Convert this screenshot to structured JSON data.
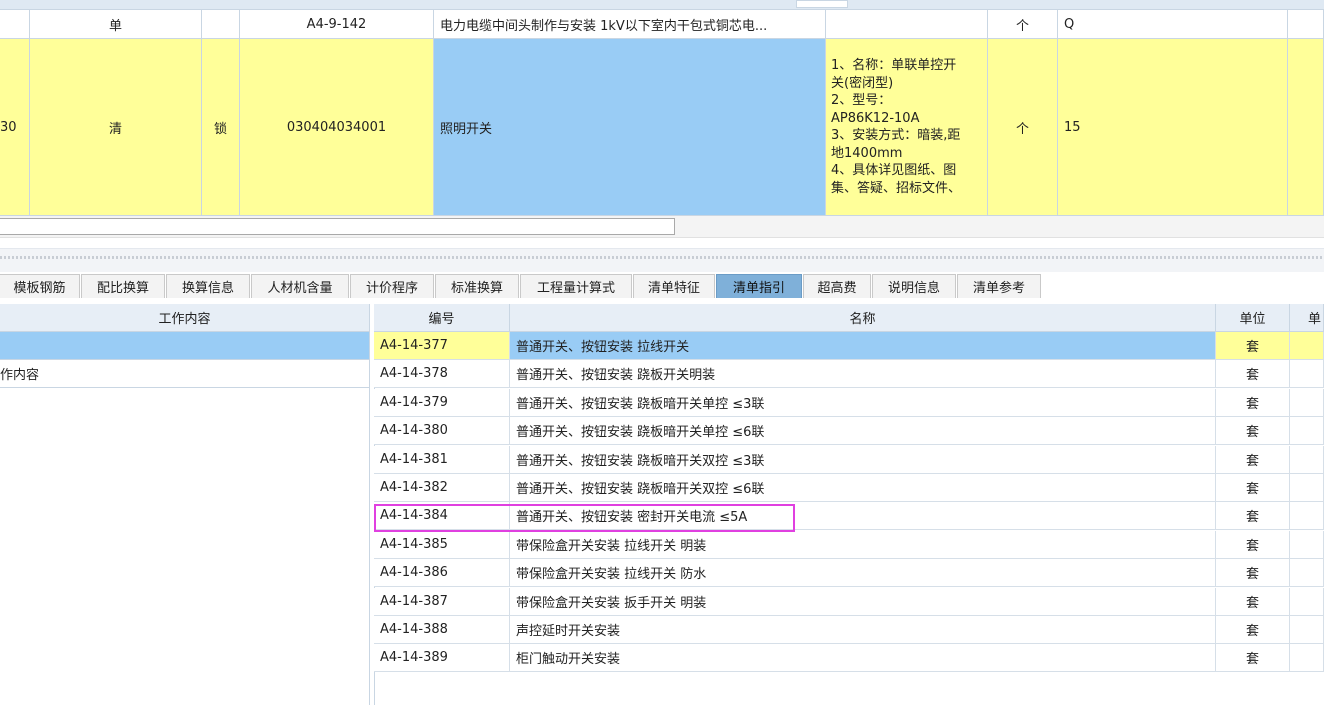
{
  "top_grid": {
    "row1": {
      "type": "单",
      "code": "A4-9-142",
      "name": "电力电缆中间头制作与安装 1kV以下室内干包式铜芯电...",
      "feature": "",
      "unit": "个",
      "qty": "Q"
    },
    "row2": {
      "seq": "30",
      "type": "清",
      "lock": "锁",
      "code": "030404034001",
      "name": "照明开关",
      "feature_lines": [
        "1、名称：单联单控开",
        "关(密闭型)",
        "2、型号：",
        "AP86K12-10A",
        "3、安装方式：暗装,距",
        "地1400mm",
        "4、具体详见图纸、图",
        "集、答疑、招标文件、"
      ],
      "unit": "个",
      "qty": "15"
    }
  },
  "tabs": [
    {
      "label": "模板钢筋",
      "active": false
    },
    {
      "label": "配比换算",
      "active": false
    },
    {
      "label": "换算信息",
      "active": false
    },
    {
      "label": "人材机含量",
      "active": false
    },
    {
      "label": "计价程序",
      "active": false
    },
    {
      "label": "标准换算",
      "active": false
    },
    {
      "label": "工程量计算式",
      "active": false
    },
    {
      "label": "清单特征",
      "active": false
    },
    {
      "label": "清单指引",
      "active": true
    },
    {
      "label": "超高费",
      "active": false
    },
    {
      "label": "说明信息",
      "active": false
    },
    {
      "label": "清单参考",
      "active": false
    }
  ],
  "left_panel": {
    "header": "工作内容",
    "rows": [
      "",
      "作内容"
    ]
  },
  "right_panel": {
    "headers": {
      "code": "编号",
      "name": "名称",
      "unit": "单位",
      "extra": "单"
    },
    "rows": [
      {
        "code": "A4-14-377",
        "name": "普通开关、按钮安装 拉线开关",
        "unit": "套",
        "selected": true
      },
      {
        "code": "A4-14-378",
        "name": "普通开关、按钮安装 跷板开关明装",
        "unit": "套"
      },
      {
        "code": "A4-14-379",
        "name": "普通开关、按钮安装 跷板暗开关单控 ≤3联",
        "unit": "套"
      },
      {
        "code": "A4-14-380",
        "name": "普通开关、按钮安装 跷板暗开关单控 ≤6联",
        "unit": "套"
      },
      {
        "code": "A4-14-381",
        "name": "普通开关、按钮安装 跷板暗开关双控 ≤3联",
        "unit": "套"
      },
      {
        "code": "A4-14-382",
        "name": "普通开关、按钮安装 跷板暗开关双控 ≤6联",
        "unit": "套"
      },
      {
        "code": "A4-14-384",
        "name": "普通开关、按钮安装 密封开关电流 ≤5A",
        "unit": "套",
        "highlighted": true
      },
      {
        "code": "A4-14-385",
        "name": "带保险盒开关安装 拉线开关 明装",
        "unit": "套"
      },
      {
        "code": "A4-14-386",
        "name": "带保险盒开关安装 拉线开关 防水",
        "unit": "套"
      },
      {
        "code": "A4-14-387",
        "name": "带保险盒开关安装 扳手开关 明装",
        "unit": "套"
      },
      {
        "code": "A4-14-388",
        "name": "声控延时开关安装",
        "unit": "套"
      },
      {
        "code": "A4-14-389",
        "name": "柜门触动开关安装",
        "unit": "套"
      }
    ]
  },
  "colors": {
    "yellow_row": "#ffff99",
    "selected_blue": "#99ccf5",
    "active_tab": "#7fb0d9",
    "highlight_box": "#e040e0",
    "header_bg": "#e7eef6"
  }
}
